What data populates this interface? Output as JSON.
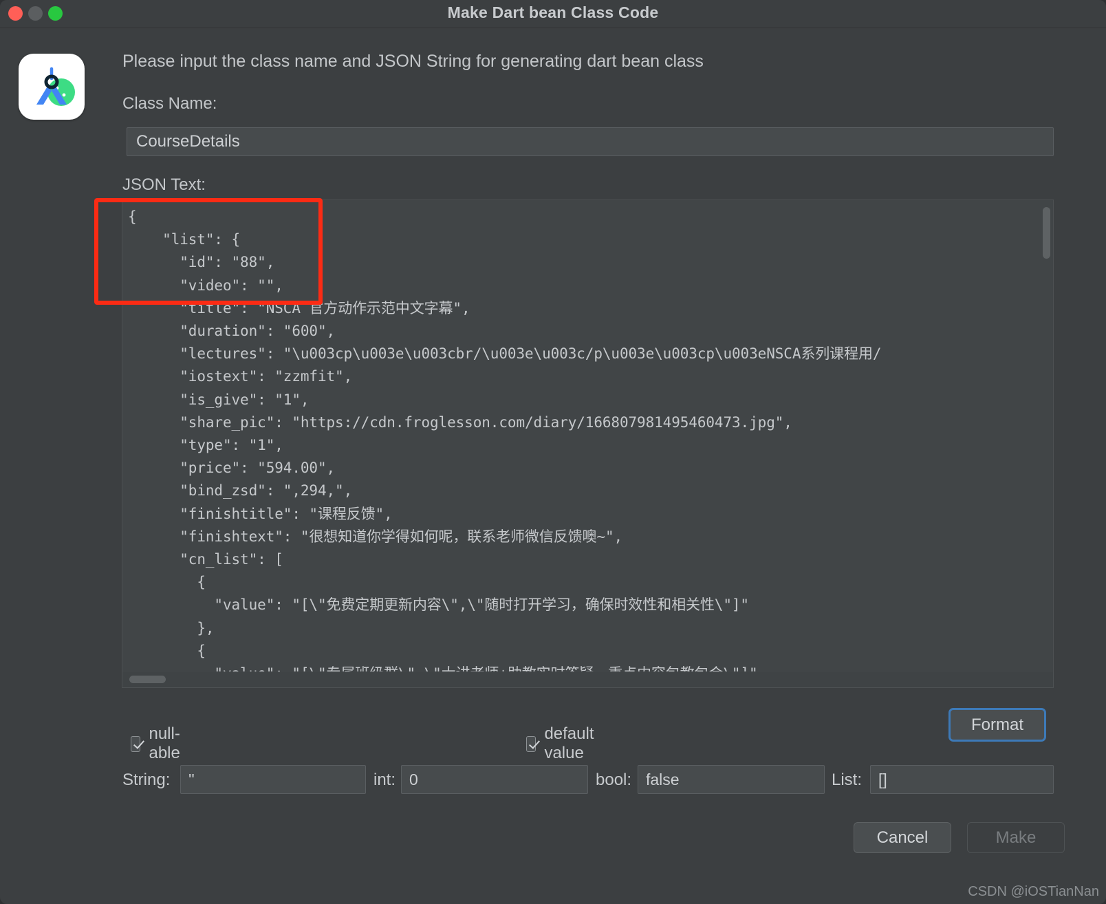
{
  "window": {
    "title": "Make Dart bean Class Code",
    "traffic_lights": [
      "close-button",
      "minimize-button",
      "zoom-button"
    ]
  },
  "icon": {
    "name": "android-studio-icon",
    "colors": {
      "blue": "#4285F4",
      "green": "#3DDC84",
      "dark": "#0F2431",
      "bg": "#FFFFFF"
    }
  },
  "content": {
    "intro_text": "Please input the class name and JSON String for generating dart bean class",
    "class_name_label": "Class Name:",
    "class_name_value": "CourseDetails",
    "json_label": "JSON Text:",
    "json_text": "{\n    \"list\": {\n      \"id\": \"88\",\n      \"video\": \"\",\n      \"title\": \"NSCA 官方动作示范中文字幕\",\n      \"duration\": \"600\",\n      \"lectures\": \"\\u003cp\\u003e\\u003cbr/\\u003e\\u003c/p\\u003e\\u003cp\\u003eNSCA系列课程用/\n      \"iostext\": \"zzmfit\",\n      \"is_give\": \"1\",\n      \"share_pic\": \"https://cdn.froglesson.com/diary/166807981495460473.jpg\",\n      \"type\": \"1\",\n      \"price\": \"594.00\",\n      \"bind_zsd\": \",294,\",\n      \"finishtitle\": \"课程反馈\",\n      \"finishtext\": \"很想知道你学得如何呢，联系老师微信反馈噢~\",\n      \"cn_list\": [\n        {\n          \"value\": \"[\\\"免费定期更新内容\\\",\\\"随时打开学习，确保时效性和相关性\\\"]\"\n        },\n        {\n          \"value\": \"[\\\"专属班级群\\\",\\\"大讲老师+助教实时答疑，重点内容包教包会\\\"]\""
  },
  "options": {
    "nullable_label": "null-able",
    "nullable_checked": true,
    "default_value_label": "default value",
    "default_value_checked": true,
    "format_label": "Format",
    "format_focus_color": "#3d7ab8"
  },
  "defaults": {
    "string_label": "String:",
    "string_value": "''",
    "int_label": "int:",
    "int_value": "0",
    "bool_label": "bool:",
    "bool_value": "false",
    "list_label": "List:",
    "list_value": "[]"
  },
  "footer": {
    "cancel_label": "Cancel",
    "make_label": "Make",
    "make_enabled": false
  },
  "watermark": "CSDN @iOSTianNan"
}
